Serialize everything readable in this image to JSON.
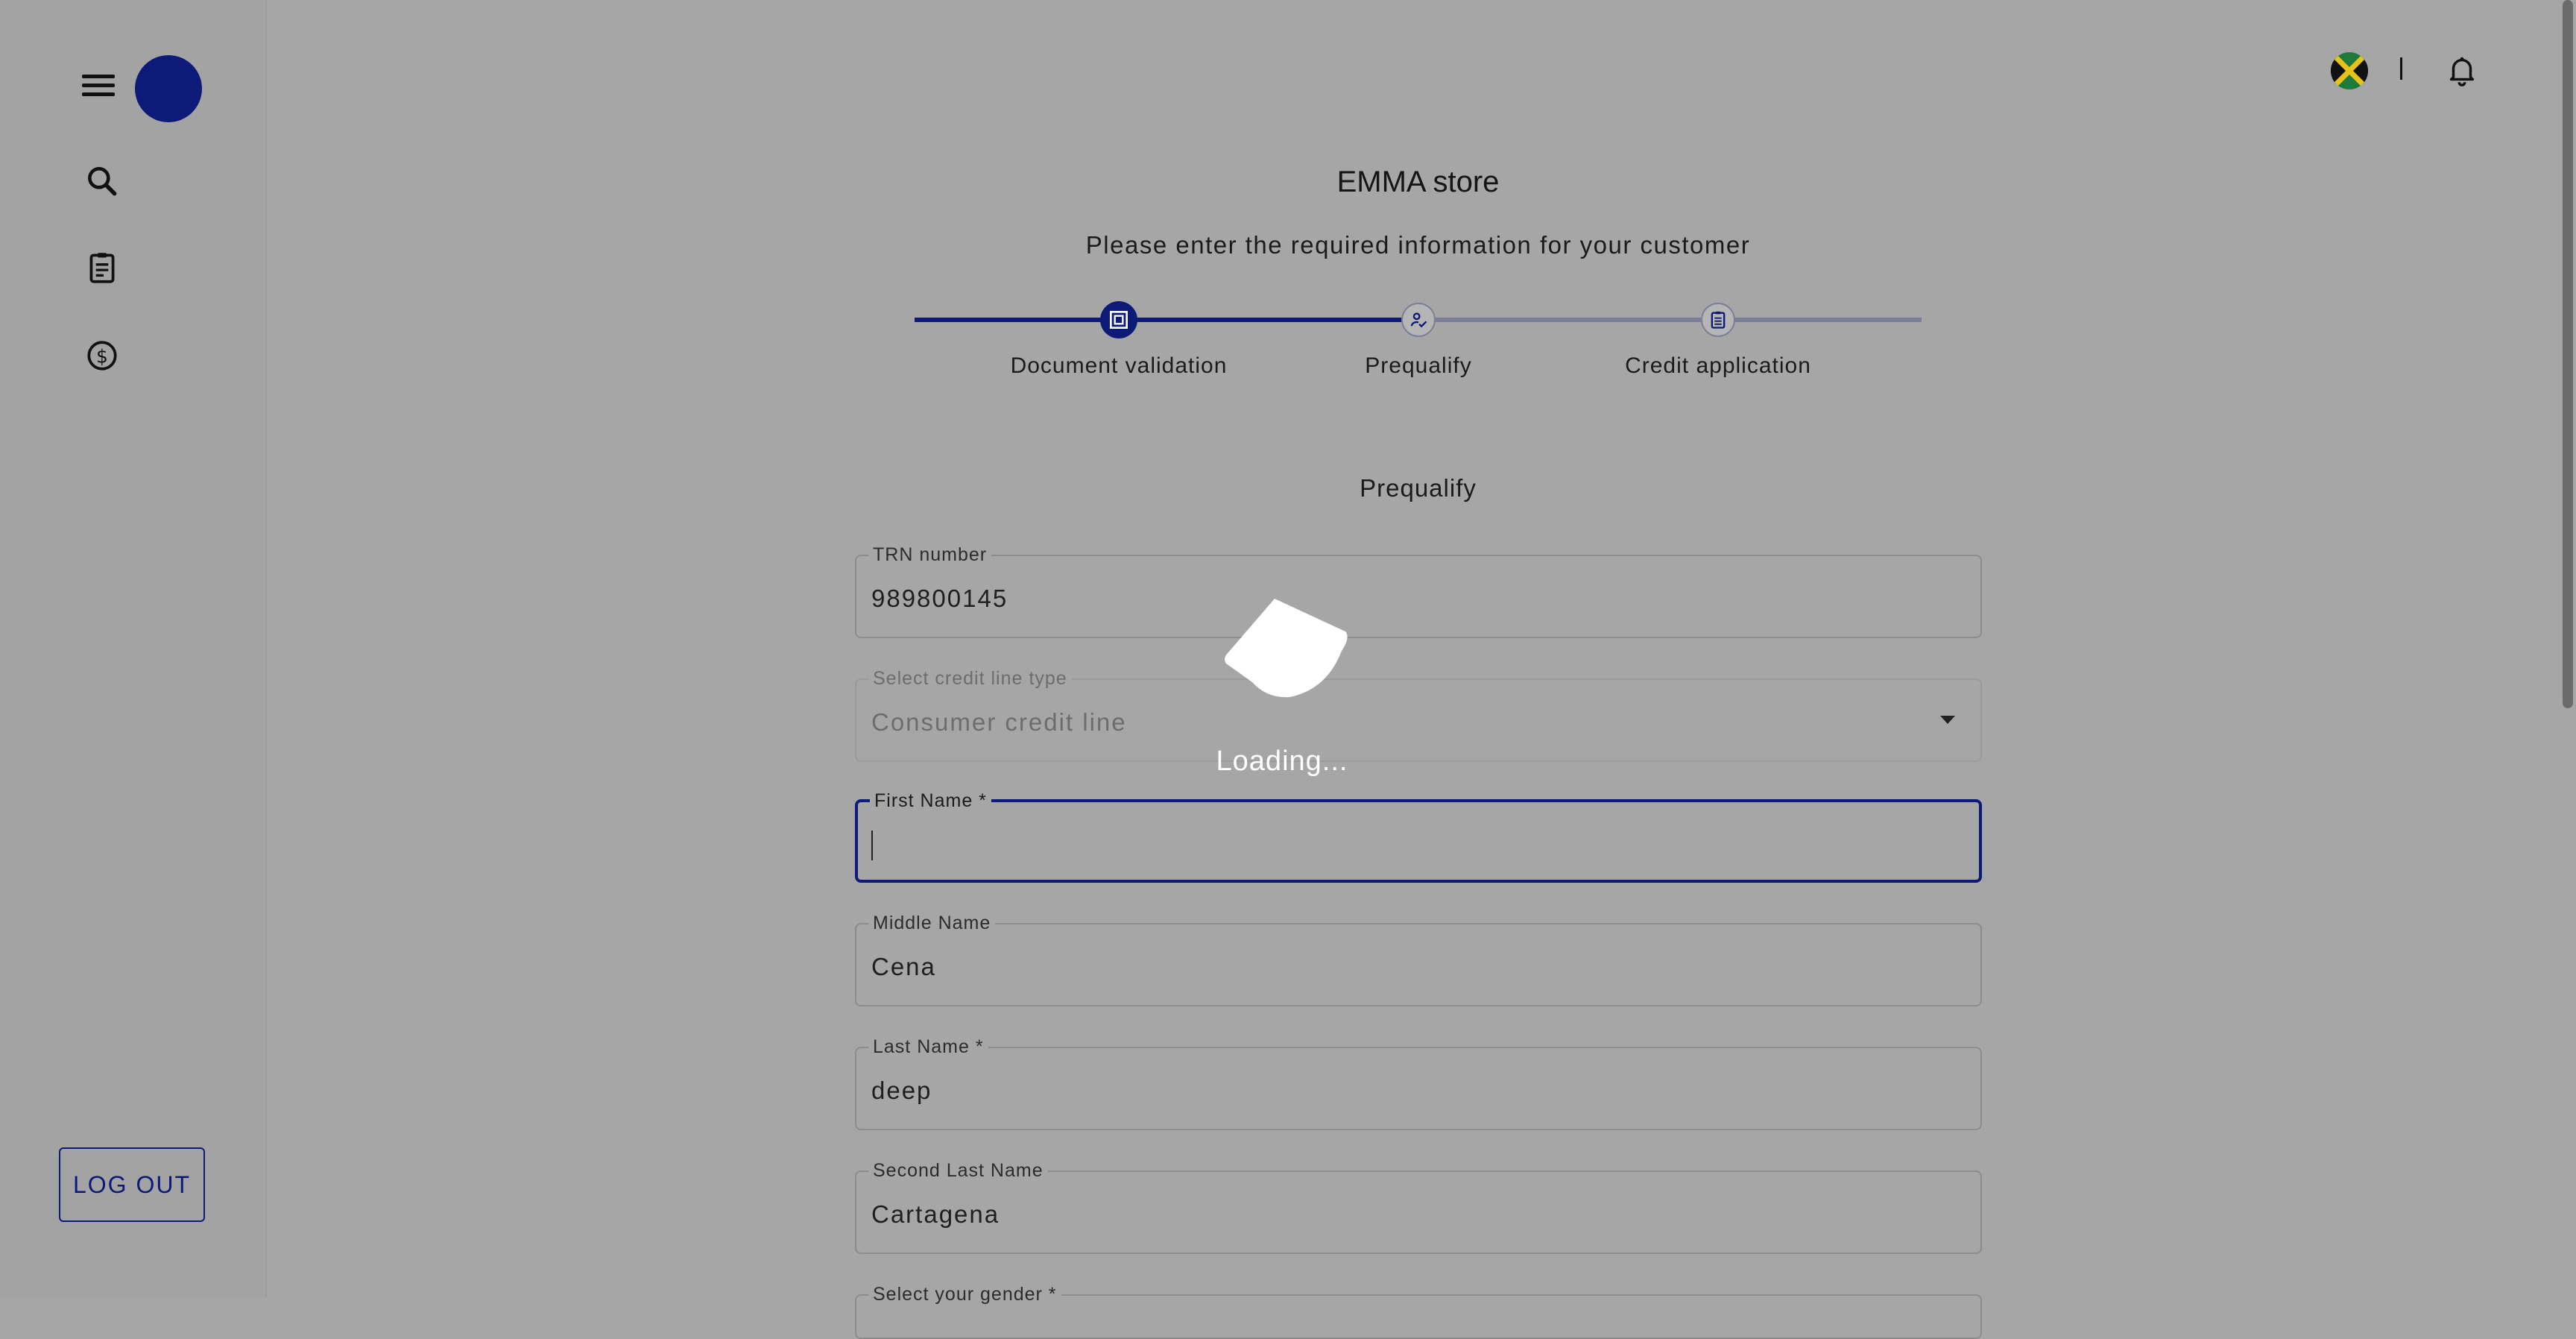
{
  "header": {
    "notification_icon": "bell-icon",
    "country_flag": "jamaica-flag-icon"
  },
  "sidebar": {
    "items": [
      {
        "icon": "search-icon"
      },
      {
        "icon": "clipboard-icon"
      },
      {
        "icon": "dollar-circle-icon"
      }
    ],
    "logout_label": "LOG OUT"
  },
  "page": {
    "store_name": "EMMA store",
    "subtitle": "Please enter the required information for your customer",
    "section_title": "Prequalify"
  },
  "stepper": {
    "steps": [
      {
        "label": "Document validation",
        "state": "completed"
      },
      {
        "label": "Prequalify",
        "state": "active"
      },
      {
        "label": "Credit application",
        "state": "pending"
      }
    ]
  },
  "form": {
    "trn": {
      "label": "TRN number",
      "value": "989800145"
    },
    "credit_line": {
      "label": "Select credit line type",
      "value": "Consumer credit line"
    },
    "first_name": {
      "label": "First Name *",
      "value": ""
    },
    "middle_name": {
      "label": "Middle Name",
      "value": "Cena"
    },
    "last_name": {
      "label": "Last Name *",
      "value": "deep"
    },
    "second_last_name": {
      "label": "Second Last Name",
      "value": "Cartagena"
    },
    "gender": {
      "label": "Select your gender *"
    }
  },
  "overlay": {
    "loading_text": "Loading..."
  },
  "colors": {
    "primary": "#0d1a78",
    "overlay_bg": "#a6a6a6",
    "inactive_line": "#7a7f97"
  }
}
